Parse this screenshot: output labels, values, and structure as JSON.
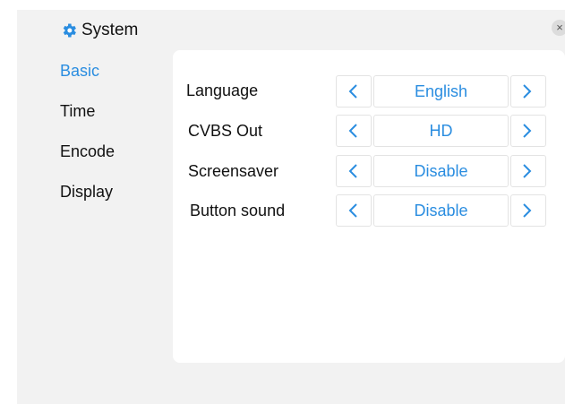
{
  "window": {
    "title": "System",
    "title_icon": "gear-icon",
    "close_label": "×"
  },
  "nav": {
    "items": [
      {
        "label": "Basic",
        "active": true
      },
      {
        "label": "Time",
        "active": false
      },
      {
        "label": "Encode",
        "active": false
      },
      {
        "label": "Display",
        "active": false
      }
    ]
  },
  "settings": [
    {
      "label": "Language",
      "value": "English"
    },
    {
      "label": "CVBS Out",
      "value": "HD"
    },
    {
      "label": "Screensaver",
      "value": "Disable"
    },
    {
      "label": "Button sound",
      "value": "Disable"
    }
  ],
  "colors": {
    "accent": "#2a8de0",
    "background": "#f2f2f2",
    "panel": "#ffffff"
  }
}
